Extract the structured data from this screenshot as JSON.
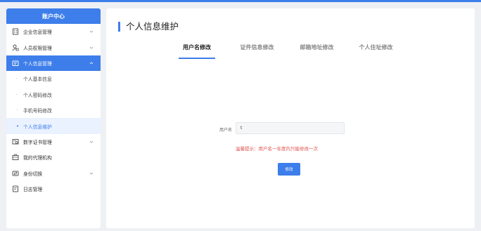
{
  "sidebar": {
    "title": "账户中心",
    "items": [
      {
        "label": "企业信息管理",
        "icon": "building-icon",
        "expandable": true
      },
      {
        "label": "人员权限管理",
        "icon": "user-lock-icon",
        "expandable": true
      },
      {
        "label": "个人信息管理",
        "icon": "id-card-icon",
        "expandable": true,
        "active": true,
        "children": [
          {
            "label": "个人基本信息"
          },
          {
            "label": "个人密码修改"
          },
          {
            "label": "手机号码修改"
          },
          {
            "label": "个人信息维护",
            "current": true
          }
        ]
      },
      {
        "label": "数字证书管理",
        "icon": "certificate-icon",
        "expandable": true
      },
      {
        "label": "我的代理机构",
        "icon": "agency-icon",
        "expandable": false
      },
      {
        "label": "身份切换",
        "icon": "switch-icon",
        "expandable": true
      },
      {
        "label": "日志管理",
        "icon": "log-icon",
        "expandable": false
      }
    ]
  },
  "main": {
    "title": "个人信息维护",
    "tabs": [
      {
        "label": "用户名修改",
        "active": true
      },
      {
        "label": "证件信息修改"
      },
      {
        "label": "邮箱地址修改"
      },
      {
        "label": "个人住址修改"
      }
    ],
    "form": {
      "username_label": "用户名",
      "username_value": "t",
      "hint": "温馨提示：用户名一年度内只能修改一次",
      "submit_label": "修改"
    }
  },
  "colors": {
    "accent": "#3d7eea",
    "warning": "#e05050",
    "background": "#eef0f4"
  }
}
